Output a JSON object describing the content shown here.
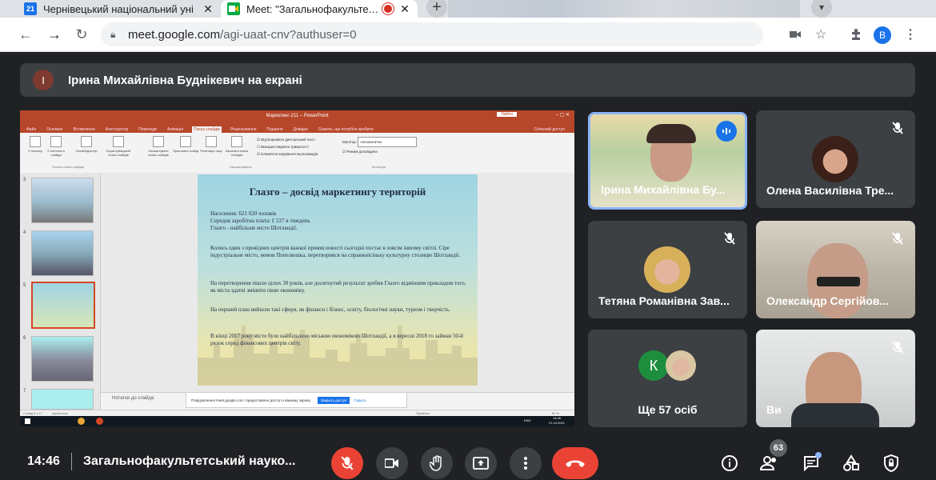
{
  "browser": {
    "tabs": [
      {
        "title": "Чернівецький національний уні",
        "favicon": "calendar-21-icon",
        "fav_text": "21",
        "fav_color": "#1a73e8"
      },
      {
        "title": "Meet: \"Загальнофакультетсь",
        "favicon": "meet-icon",
        "fav_color": "#00ac47",
        "recording": true
      }
    ],
    "url": {
      "host": "meet.google.com",
      "path": "/agi-uaat-cnv?authuser=0"
    },
    "profile_letter": "B"
  },
  "banner": {
    "avatar_letter": "І",
    "text": "Ірина Михайлівна Буднікевич на екрані"
  },
  "presentation": {
    "window_title": "Маркетинг-211 – PowerPoint",
    "sign_in": "Увійти",
    "ribbon_tabs": [
      "Файл",
      "Основне",
      "Вставлення",
      "Конструктор",
      "Переходи",
      "Анімація",
      "Показ слайдів",
      "Рецензування",
      "Подання",
      "Довідка",
      "Скажіть, що потрібно зробити"
    ],
    "selected_ribbon_tab": "Показ слайдів",
    "shared_access": "Спільний доступ",
    "ribbon_buttons": [
      "З початку",
      "З поточного слайда",
      "Онлайндоступ",
      "Користувацький показ слайдів",
      "Налаштувати показ слайдів",
      "Приховати слайд",
      "Репетиція часу",
      "Записати показ слайдів"
    ],
    "ribbon_checks": [
      "Відтворювати дикторський текст",
      "Використовувати тривалості",
      "Елементи керування мультимедіа"
    ],
    "monitor_label": "Монітор:",
    "monitor_value": "Автоматично",
    "presenter_view": "Режим доповідача",
    "group_labels": [
      "Почати показ слайдів",
      "Налаштування",
      "Монітори"
    ],
    "slide": {
      "title": "Глазго – досвід маркетингу територій",
      "paragraphs": [
        [
          "Населення: 621 020 чоловік",
          "Середня заробітна плата: £ 537 в тиждень",
          "Глазго - найбільше місто Шотландії."
        ],
        [
          "Колись один з провідних центрів важкої промисловості сьогодні постає в зовсім іншому світлі. Сіре індустріальне місто, немов Попелюшка, перетворився на справжнісіньку культурну столицю Шотландії."
        ],
        [
          "На перетворення пішло цілих 30 років, але досягнутий результат зробив Глазго відмінним прикладом того, як міста здатні змінити свою економіку."
        ],
        [
          "На перший план вийшли такі сфери, як фінанси і бізнес, освіту, біологічні науки, туризм і творчість."
        ],
        [
          "В кінці 2017 року місто було найбільшою міською економікою Шотландії, а в вересні 2018 го займав 50-й рядок серед фінансових центрів світу."
        ]
      ]
    },
    "thumb_numbers": [
      "3",
      "4",
      "5",
      "6",
      "7"
    ],
    "notes_placeholder": "Нотатки до слайда",
    "share_message": "Повідомлення meet.google.com: предоставлен доступ к вашему экрану.",
    "share_stop": "Закрыть доступ",
    "share_hide": "Скрыть",
    "status_slide": "Слайд 5 з 17",
    "status_lang": "українська",
    "status_notes": "Примітки",
    "status_zoom": "61 %",
    "taskbar_time": "14:46",
    "taskbar_date": "21.10.2021",
    "taskbar_lang": "ENG"
  },
  "participants": [
    {
      "name": "Ірина Михайлівна Бу...",
      "speaking": true
    },
    {
      "name": "Олена Василівна Тре...",
      "muted": true
    },
    {
      "name": "Тетяна Романівна Зав...",
      "muted": true
    },
    {
      "name": "Олександр Сергійов...",
      "muted": true
    },
    {
      "name": "Ще 57 осіб",
      "avatar_letter": "К"
    },
    {
      "name": "Ви",
      "muted": true
    }
  ],
  "bottom_bar": {
    "time": "14:46",
    "meeting_title": "Загальнофакультетський науко...",
    "participant_count": "63"
  }
}
